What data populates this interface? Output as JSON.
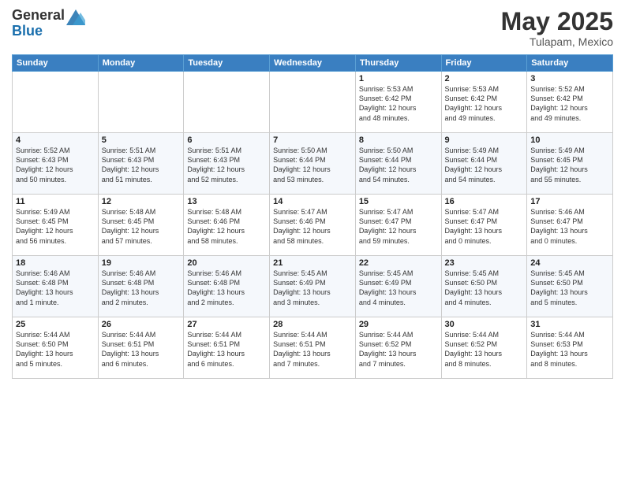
{
  "logo": {
    "general": "General",
    "blue": "Blue"
  },
  "title": "May 2025",
  "location": "Tulapam, Mexico",
  "days_header": [
    "Sunday",
    "Monday",
    "Tuesday",
    "Wednesday",
    "Thursday",
    "Friday",
    "Saturday"
  ],
  "weeks": [
    [
      {
        "day": "",
        "info": ""
      },
      {
        "day": "",
        "info": ""
      },
      {
        "day": "",
        "info": ""
      },
      {
        "day": "",
        "info": ""
      },
      {
        "day": "1",
        "info": "Sunrise: 5:53 AM\nSunset: 6:42 PM\nDaylight: 12 hours\nand 48 minutes."
      },
      {
        "day": "2",
        "info": "Sunrise: 5:53 AM\nSunset: 6:42 PM\nDaylight: 12 hours\nand 49 minutes."
      },
      {
        "day": "3",
        "info": "Sunrise: 5:52 AM\nSunset: 6:42 PM\nDaylight: 12 hours\nand 49 minutes."
      }
    ],
    [
      {
        "day": "4",
        "info": "Sunrise: 5:52 AM\nSunset: 6:43 PM\nDaylight: 12 hours\nand 50 minutes."
      },
      {
        "day": "5",
        "info": "Sunrise: 5:51 AM\nSunset: 6:43 PM\nDaylight: 12 hours\nand 51 minutes."
      },
      {
        "day": "6",
        "info": "Sunrise: 5:51 AM\nSunset: 6:43 PM\nDaylight: 12 hours\nand 52 minutes."
      },
      {
        "day": "7",
        "info": "Sunrise: 5:50 AM\nSunset: 6:44 PM\nDaylight: 12 hours\nand 53 minutes."
      },
      {
        "day": "8",
        "info": "Sunrise: 5:50 AM\nSunset: 6:44 PM\nDaylight: 12 hours\nand 54 minutes."
      },
      {
        "day": "9",
        "info": "Sunrise: 5:49 AM\nSunset: 6:44 PM\nDaylight: 12 hours\nand 54 minutes."
      },
      {
        "day": "10",
        "info": "Sunrise: 5:49 AM\nSunset: 6:45 PM\nDaylight: 12 hours\nand 55 minutes."
      }
    ],
    [
      {
        "day": "11",
        "info": "Sunrise: 5:49 AM\nSunset: 6:45 PM\nDaylight: 12 hours\nand 56 minutes."
      },
      {
        "day": "12",
        "info": "Sunrise: 5:48 AM\nSunset: 6:45 PM\nDaylight: 12 hours\nand 57 minutes."
      },
      {
        "day": "13",
        "info": "Sunrise: 5:48 AM\nSunset: 6:46 PM\nDaylight: 12 hours\nand 58 minutes."
      },
      {
        "day": "14",
        "info": "Sunrise: 5:47 AM\nSunset: 6:46 PM\nDaylight: 12 hours\nand 58 minutes."
      },
      {
        "day": "15",
        "info": "Sunrise: 5:47 AM\nSunset: 6:47 PM\nDaylight: 12 hours\nand 59 minutes."
      },
      {
        "day": "16",
        "info": "Sunrise: 5:47 AM\nSunset: 6:47 PM\nDaylight: 13 hours\nand 0 minutes."
      },
      {
        "day": "17",
        "info": "Sunrise: 5:46 AM\nSunset: 6:47 PM\nDaylight: 13 hours\nand 0 minutes."
      }
    ],
    [
      {
        "day": "18",
        "info": "Sunrise: 5:46 AM\nSunset: 6:48 PM\nDaylight: 13 hours\nand 1 minute."
      },
      {
        "day": "19",
        "info": "Sunrise: 5:46 AM\nSunset: 6:48 PM\nDaylight: 13 hours\nand 2 minutes."
      },
      {
        "day": "20",
        "info": "Sunrise: 5:46 AM\nSunset: 6:48 PM\nDaylight: 13 hours\nand 2 minutes."
      },
      {
        "day": "21",
        "info": "Sunrise: 5:45 AM\nSunset: 6:49 PM\nDaylight: 13 hours\nand 3 minutes."
      },
      {
        "day": "22",
        "info": "Sunrise: 5:45 AM\nSunset: 6:49 PM\nDaylight: 13 hours\nand 4 minutes."
      },
      {
        "day": "23",
        "info": "Sunrise: 5:45 AM\nSunset: 6:50 PM\nDaylight: 13 hours\nand 4 minutes."
      },
      {
        "day": "24",
        "info": "Sunrise: 5:45 AM\nSunset: 6:50 PM\nDaylight: 13 hours\nand 5 minutes."
      }
    ],
    [
      {
        "day": "25",
        "info": "Sunrise: 5:44 AM\nSunset: 6:50 PM\nDaylight: 13 hours\nand 5 minutes."
      },
      {
        "day": "26",
        "info": "Sunrise: 5:44 AM\nSunset: 6:51 PM\nDaylight: 13 hours\nand 6 minutes."
      },
      {
        "day": "27",
        "info": "Sunrise: 5:44 AM\nSunset: 6:51 PM\nDaylight: 13 hours\nand 6 minutes."
      },
      {
        "day": "28",
        "info": "Sunrise: 5:44 AM\nSunset: 6:51 PM\nDaylight: 13 hours\nand 7 minutes."
      },
      {
        "day": "29",
        "info": "Sunrise: 5:44 AM\nSunset: 6:52 PM\nDaylight: 13 hours\nand 7 minutes."
      },
      {
        "day": "30",
        "info": "Sunrise: 5:44 AM\nSunset: 6:52 PM\nDaylight: 13 hours\nand 8 minutes."
      },
      {
        "day": "31",
        "info": "Sunrise: 5:44 AM\nSunset: 6:53 PM\nDaylight: 13 hours\nand 8 minutes."
      }
    ]
  ]
}
